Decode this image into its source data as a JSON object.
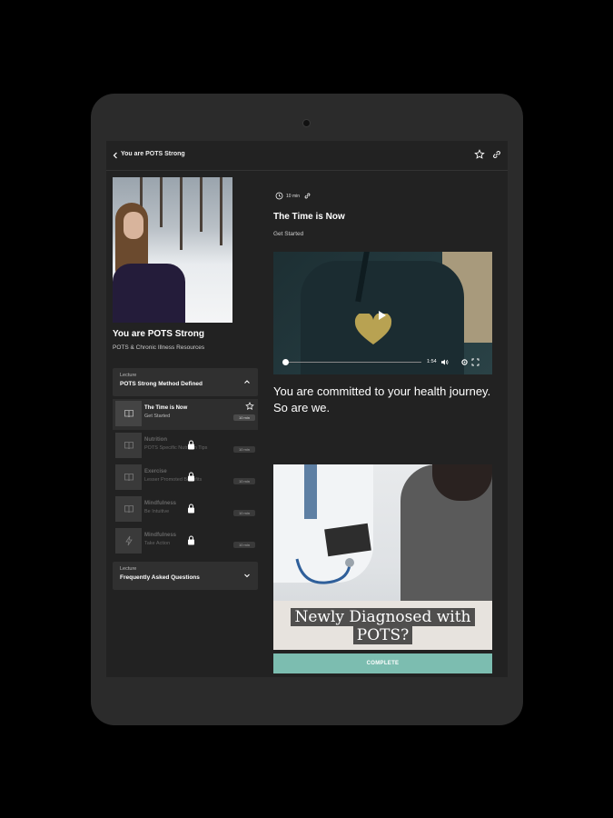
{
  "topbar": {
    "title": "You are POTS Strong"
  },
  "course": {
    "title": "You are POTS Strong",
    "subtitle": "POTS & Chronic Illness Resources"
  },
  "sections": [
    {
      "kind": "Lecture",
      "name": "POTS Strong Method Defined",
      "expanded": true
    },
    {
      "kind": "Lecture",
      "name": "Frequently Asked Questions",
      "expanded": false
    }
  ],
  "lessons": [
    {
      "title": "The Time is Now",
      "subtitle": "Get Started",
      "duration": "10 min",
      "locked": false,
      "active": true,
      "icon": "book-icon"
    },
    {
      "title": "Nutrition",
      "subtitle": "POTS Specific Nutrition Tips",
      "duration": "10 min",
      "locked": true,
      "active": false,
      "icon": "book-icon"
    },
    {
      "title": "Exercise",
      "subtitle": "Lesser Promoted Benefits",
      "duration": "10 min",
      "locked": true,
      "active": false,
      "icon": "book-icon"
    },
    {
      "title": "Mindfulness",
      "subtitle": "Be Intuitive",
      "duration": "10 min",
      "locked": true,
      "active": false,
      "icon": "book-icon"
    },
    {
      "title": "Mindfulness",
      "subtitle": "Take Action",
      "duration": "10 min",
      "locked": true,
      "active": false,
      "icon": "bolt-icon"
    }
  ],
  "lesson_detail": {
    "duration": "10 min",
    "title": "The Time is Now",
    "subtitle": "Get Started",
    "video": {
      "time": "1:54",
      "progress": 0.0
    },
    "body_line1": "You are committed to your health journey.",
    "body_line2": "So are we.",
    "promo_caption_line1": "Newly Diagnosed with",
    "promo_caption_line2": "POTS?",
    "complete_label": "COMPLETE"
  },
  "colors": {
    "accent": "#7cbdb0",
    "background": "#222222",
    "panel": "#303030"
  }
}
